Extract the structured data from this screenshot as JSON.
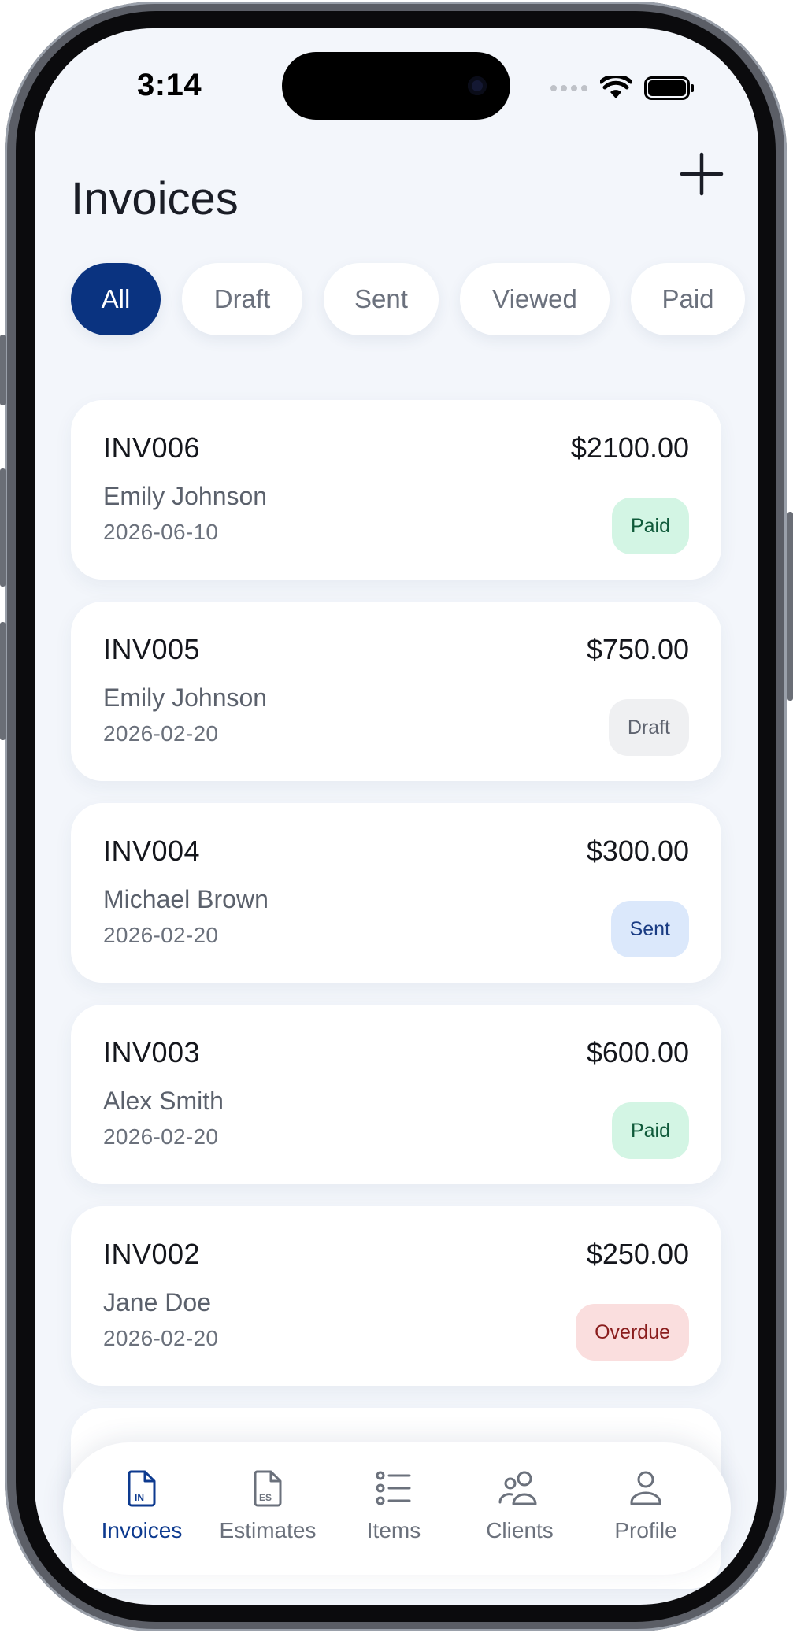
{
  "status_bar": {
    "time": "3:14"
  },
  "header": {
    "title": "Invoices"
  },
  "filters": [
    {
      "label": "All",
      "active": true
    },
    {
      "label": "Draft",
      "active": false
    },
    {
      "label": "Sent",
      "active": false
    },
    {
      "label": "Viewed",
      "active": false
    },
    {
      "label": "Paid",
      "active": false
    }
  ],
  "invoices": [
    {
      "number": "INV006",
      "amount": "$2100.00",
      "client": "Emily Johnson",
      "date": "2026-06-10",
      "status": "Paid"
    },
    {
      "number": "INV005",
      "amount": "$750.00",
      "client": "Emily Johnson",
      "date": "2026-02-20",
      "status": "Draft"
    },
    {
      "number": "INV004",
      "amount": "$300.00",
      "client": "Michael Brown",
      "date": "2026-02-20",
      "status": "Sent"
    },
    {
      "number": "INV003",
      "amount": "$600.00",
      "client": "Alex Smith",
      "date": "2026-02-20",
      "status": "Paid"
    },
    {
      "number": "INV002",
      "amount": "$250.00",
      "client": "Jane Doe",
      "date": "2026-02-20",
      "status": "Overdue"
    }
  ],
  "tabbar": [
    {
      "label": "Invoices",
      "icon": "invoice-doc-icon",
      "badge": "IN",
      "active": true
    },
    {
      "label": "Estimates",
      "icon": "estimate-doc-icon",
      "badge": "ES",
      "active": false
    },
    {
      "label": "Items",
      "icon": "list-icon",
      "active": false
    },
    {
      "label": "Clients",
      "icon": "clients-icon",
      "active": false
    },
    {
      "label": "Profile",
      "icon": "profile-icon",
      "active": false
    }
  ],
  "colors": {
    "accent": "#0a3380",
    "background": "#f3f6fb"
  }
}
